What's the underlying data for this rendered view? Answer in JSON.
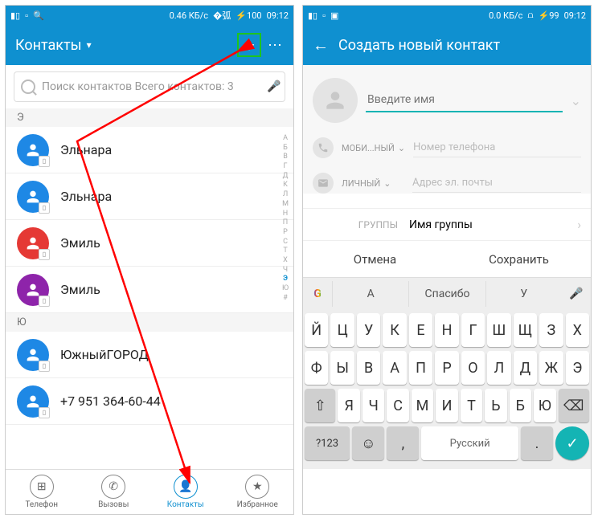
{
  "status": {
    "data_rate_left": "0.46 КБ/с",
    "data_rate_right": "0.0 КБ/с",
    "battery": "100",
    "battery_right": "99",
    "time": "09:12"
  },
  "left": {
    "title": "Контакты",
    "search_placeholder": "Поиск контактов Всего контактов: 3",
    "sections": [
      {
        "letter": "Э",
        "contacts": [
          {
            "name": "Эльнара",
            "color": "#1e88e5"
          },
          {
            "name": "Эльнара",
            "color": "#1e88e5"
          },
          {
            "name": "Эмиль",
            "color": "#e53935"
          },
          {
            "name": "Эмиль",
            "color": "#8e24aa"
          }
        ]
      },
      {
        "letter": "Ю",
        "contacts": [
          {
            "name": "ЮжныйГОРОД",
            "color": "#1e88e5"
          },
          {
            "name": "+7 951 364-60-44",
            "color": "#1e88e5"
          }
        ]
      }
    ],
    "alpha": [
      "А",
      "Б",
      "В",
      "Г",
      "Д",
      "К",
      "Л",
      "М",
      "Н",
      "П",
      "Р",
      "С",
      "Т",
      "Х",
      "Ч",
      "Э",
      "Ю",
      "#"
    ],
    "alpha_active": "Э",
    "nav": [
      {
        "label": "Телефон",
        "icon": "dial"
      },
      {
        "label": "Вызовы",
        "icon": "phone"
      },
      {
        "label": "Контакты",
        "icon": "person",
        "active": true
      },
      {
        "label": "Избранное",
        "icon": "star"
      }
    ]
  },
  "right": {
    "title": "Создать новый контакт",
    "name_placeholder": "Введите имя",
    "phone_label": "МОБИ...НЫЙ",
    "phone_placeholder": "Номер телефона",
    "email_label": "ЛИЧНЫЙ",
    "email_placeholder": "Адрес эл. почты",
    "group_label": "ГРУППЫ",
    "group_value": "Имя группы",
    "cancel": "Отмена",
    "save": "Сохранить",
    "suggestions": [
      "А",
      "Спасибо",
      "У"
    ],
    "keyboard": {
      "row1": [
        "Й",
        "Ц",
        "У",
        "К",
        "Е",
        "Н",
        "Г",
        "Ш",
        "Щ",
        "З",
        "Х"
      ],
      "row2": [
        "Ф",
        "Ы",
        "В",
        "А",
        "П",
        "Р",
        "О",
        "Л",
        "Д",
        "Ж",
        "Э"
      ],
      "row3": [
        "Я",
        "Ч",
        "С",
        "М",
        "И",
        "Т",
        "Ь",
        "Б",
        "Ю"
      ],
      "numkey": "?123",
      "lang": "Русский"
    }
  }
}
